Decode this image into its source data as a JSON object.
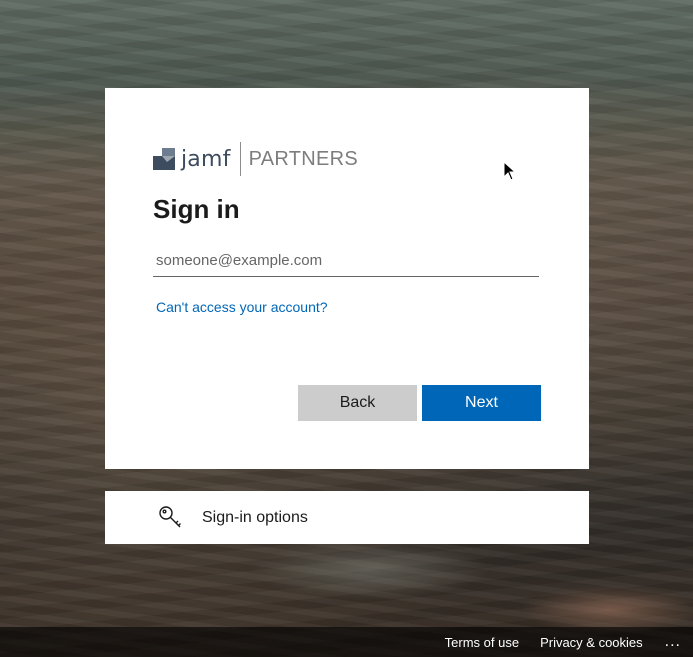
{
  "branding": {
    "logo_word": "jamf",
    "logo_partners": "PARTNERS",
    "colors": {
      "logo_mark": "#3d4c5e",
      "accent": "#0067b8"
    }
  },
  "signin": {
    "title": "Sign in",
    "email_placeholder": "someone@example.com",
    "email_value": "",
    "cant_access_link": "Can't access your account?",
    "back_label": "Back",
    "next_label": "Next"
  },
  "options": {
    "label": "Sign-in options",
    "icon": "key-icon"
  },
  "footer": {
    "terms": "Terms of use",
    "privacy": "Privacy & cookies",
    "more": "..."
  }
}
